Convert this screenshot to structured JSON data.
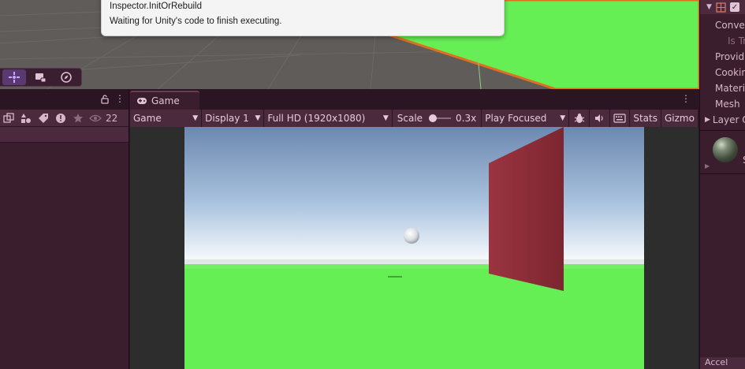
{
  "dialog": {
    "title": "Inspector.InitOrRebuild",
    "message": "Waiting for Unity's code to finish executing."
  },
  "scene_toolbar": {
    "tools": [
      "move-tool",
      "camera-tool",
      "navigation-tool"
    ],
    "active_index": 0
  },
  "hierarchy": {
    "visible_count": "22"
  },
  "game": {
    "tab_label": "Game",
    "toolbar": {
      "view_mode": "Game",
      "display": "Display 1",
      "resolution": "Full HD (1920x1080)",
      "scale_label": "Scale",
      "scale_value": "0.3x",
      "scale_fraction": 0.0,
      "play_mode": "Play Focused",
      "stats_label": "Stats",
      "gizmos_label": "Gizmo"
    }
  },
  "inspector": {
    "rows": [
      "Convex",
      "Is Tr",
      "Provid",
      "Cookin",
      "Materi",
      "Mesh",
      "Layer O"
    ],
    "material_label": "S",
    "bottom_label": "Accel"
  },
  "colors": {
    "accent": "#5a3970",
    "panel": "#3b1e2e",
    "toolbar": "#4a2a3c",
    "ground": "#66ee55",
    "wall": "#8b2d38",
    "selection_outline": "#e0701f"
  }
}
